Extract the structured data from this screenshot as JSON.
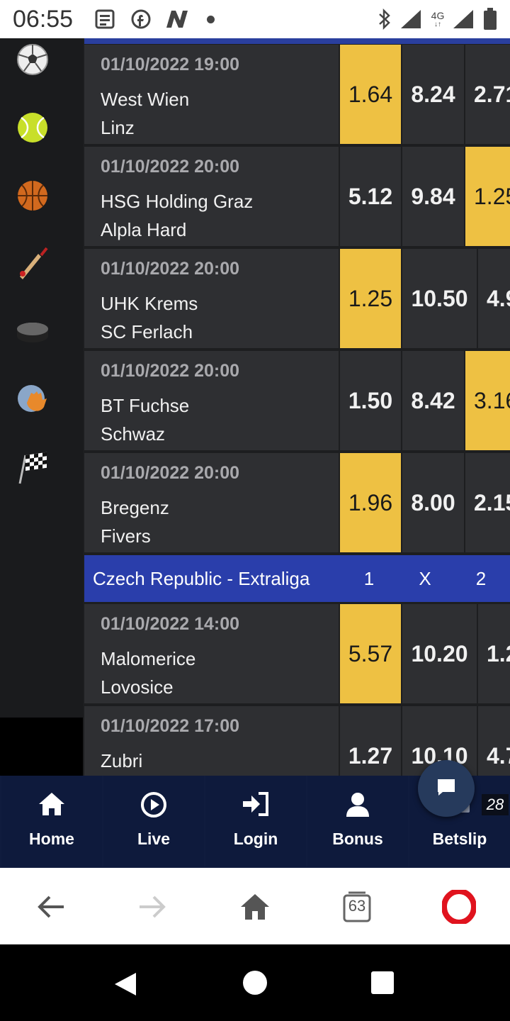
{
  "status_bar": {
    "time": "06:55",
    "network_label": "4G"
  },
  "leagues": [
    {
      "name": "Czech Republic - Extraliga",
      "col1": "1",
      "colx": "X",
      "col2": "2"
    }
  ],
  "matches": [
    {
      "datetime": "01/10/2022 19:00",
      "team1": "West Wien",
      "team2": "Linz",
      "odds": [
        "1.64",
        "8.24",
        "2.71"
      ],
      "highlight": 0
    },
    {
      "datetime": "01/10/2022 20:00",
      "team1": "HSG Holding Graz",
      "team2": "Alpla Hard",
      "odds": [
        "5.12",
        "9.84",
        "1.25"
      ],
      "highlight": 2
    },
    {
      "datetime": "01/10/2022 20:00",
      "team1": "UHK Krems",
      "team2": "SC Ferlach",
      "odds": [
        "1.25",
        "10.50",
        "4.9"
      ],
      "highlight": 0
    },
    {
      "datetime": "01/10/2022 20:00",
      "team1": "BT Fuchse",
      "team2": "Schwaz",
      "odds": [
        "1.50",
        "8.42",
        "3.16"
      ],
      "highlight": 2
    },
    {
      "datetime": "01/10/2022 20:00",
      "team1": "Bregenz",
      "team2": "Fivers",
      "odds": [
        "1.96",
        "8.00",
        "2.15"
      ],
      "highlight": 0
    },
    {
      "datetime": "01/10/2022 14:00",
      "team1": "Malomerice",
      "team2": "Lovosice",
      "odds": [
        "5.57",
        "10.20",
        "1.2"
      ],
      "highlight": 0
    },
    {
      "datetime": "01/10/2022 17:00",
      "team1": "Zubri",
      "team2": "",
      "odds": [
        "1.27",
        "10.10",
        "4.7"
      ],
      "highlight": -1
    }
  ],
  "bottom_nav": {
    "home": "Home",
    "live": "Live",
    "login": "Login",
    "bonus": "Bonus",
    "betslip": "Betslip",
    "betslip_count": "28"
  },
  "browser": {
    "tab_count": "63"
  },
  "colors": {
    "highlight": "#eec143",
    "league_bar": "#2a3eab",
    "nav_bg": "#0e1a3c",
    "row_bg": "#2e2f32"
  }
}
